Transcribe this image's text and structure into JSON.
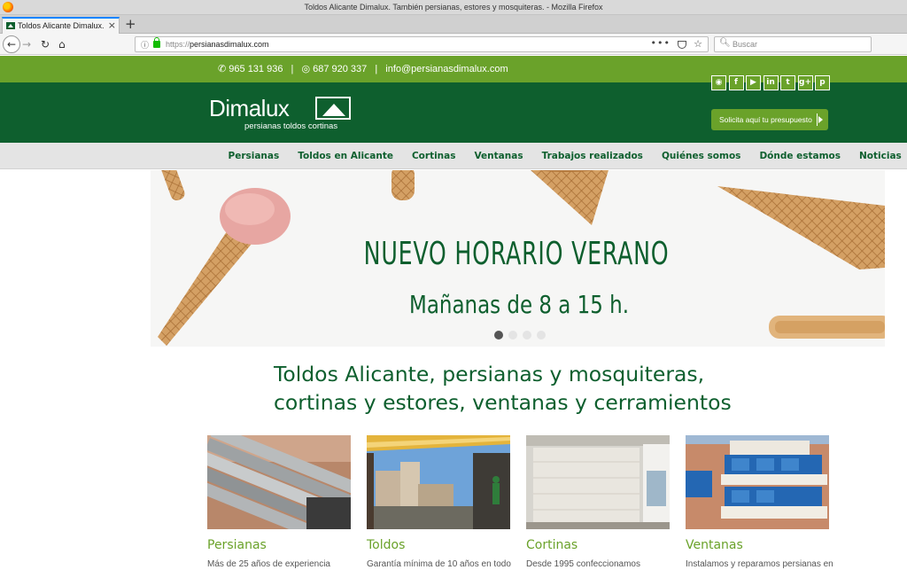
{
  "browser": {
    "window_title": "Toldos Alicante Dimalux. También persianas, estores y mosquiteras. - Mozilla Firefox",
    "tab_title": "Toldos Alicante Dimalux. Ta",
    "tab_close": "×",
    "new_tab": "+",
    "url_proto": "https://",
    "url_host": "persianasdimalux.com",
    "search_placeholder": "Buscar",
    "icons": [
      "firefox-logo",
      "back-arrow",
      "forward-arrow",
      "reload",
      "home",
      "info",
      "lock",
      "more",
      "pocket",
      "star",
      "search"
    ]
  },
  "site": {
    "contact": {
      "phone": "965 131 936",
      "whatsapp": "687 920 337",
      "email": "info@persianasdimalux.com",
      "separator": "|"
    },
    "logo": {
      "word": "Dimalux",
      "tagline": "persianas toldos cortinas"
    },
    "social": [
      {
        "name": "rss",
        "glyph": "◉"
      },
      {
        "name": "facebook",
        "glyph": "f"
      },
      {
        "name": "youtube",
        "glyph": "▶"
      },
      {
        "name": "linkedin",
        "glyph": "in"
      },
      {
        "name": "twitter",
        "glyph": "t"
      },
      {
        "name": "google-plus",
        "glyph": "g+"
      },
      {
        "name": "pinterest",
        "glyph": "p"
      }
    ],
    "quote_button": "Solicita aquí tu presupuesto",
    "nav": [
      "Persianas",
      "Toldos en Alicante",
      "Cortinas",
      "Ventanas",
      "Trabajos realizados",
      "Quiénes somos",
      "Dónde estamos",
      "Noticias"
    ],
    "slider": {
      "headline": "NUEVO HORARIO VERANO",
      "subline": "Mañanas de 8 a 15 h.",
      "dots": 4,
      "active_dot": 0
    },
    "intro_line1": "Toldos Alicante, persianas y mosquiteras,",
    "intro_line2": "cortinas y estores, ventanas y cerramientos",
    "cards": [
      {
        "title": "Persianas",
        "desc": "Más de 25 años de experiencia"
      },
      {
        "title": "Toldos",
        "desc": "Garantía mínima de 10 años en todo"
      },
      {
        "title": "Cortinas",
        "desc": "Desde 1995 confeccionamos"
      },
      {
        "title": "Ventanas",
        "desc": "Instalamos y reparamos persianas en"
      }
    ],
    "colors": {
      "green_dark": "#0e5f2e",
      "green_light": "#6aa22a",
      "nav_bg": "#e4e4e4"
    }
  }
}
